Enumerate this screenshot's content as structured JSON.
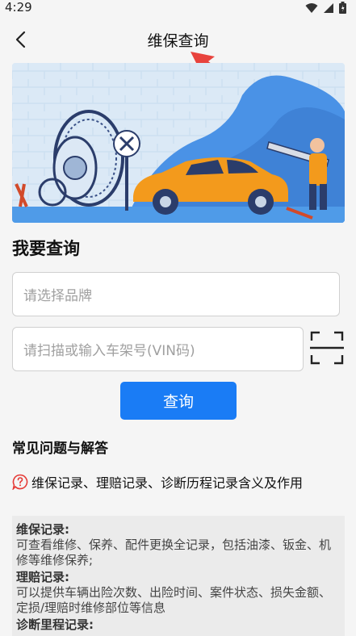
{
  "status": {
    "time": "4:29"
  },
  "header": {
    "title": "维保查询"
  },
  "query": {
    "title": "我要查询",
    "brand_placeholder": "请选择品牌",
    "vin_placeholder": "请扫描或输入车架号(VIN码)",
    "submit_label": "查询"
  },
  "faq": {
    "title": "常见问题与解答",
    "question": "维保记录、理赔记录、诊断历程记录含义及作用",
    "answers": [
      {
        "label": "维保记录:",
        "text": "可查看维修、保养、配件更换全记录，包括油漆、钣金、机修等维修保养;"
      },
      {
        "label": "理赔记录:",
        "text": "可以提供车辆出险次数、出险时间、案件状态、损失金额、定损/理赔时维修部位等信息"
      },
      {
        "label": "诊断里程记录:",
        "text": ""
      }
    ]
  },
  "colors": {
    "accent": "#1a7cf5",
    "car": "#f39a1c",
    "question_icon": "#e53935"
  },
  "icons": [
    "back-arrow-icon",
    "wifi-icon",
    "signal-icon",
    "battery-icon",
    "scan-icon",
    "question-icon"
  ]
}
